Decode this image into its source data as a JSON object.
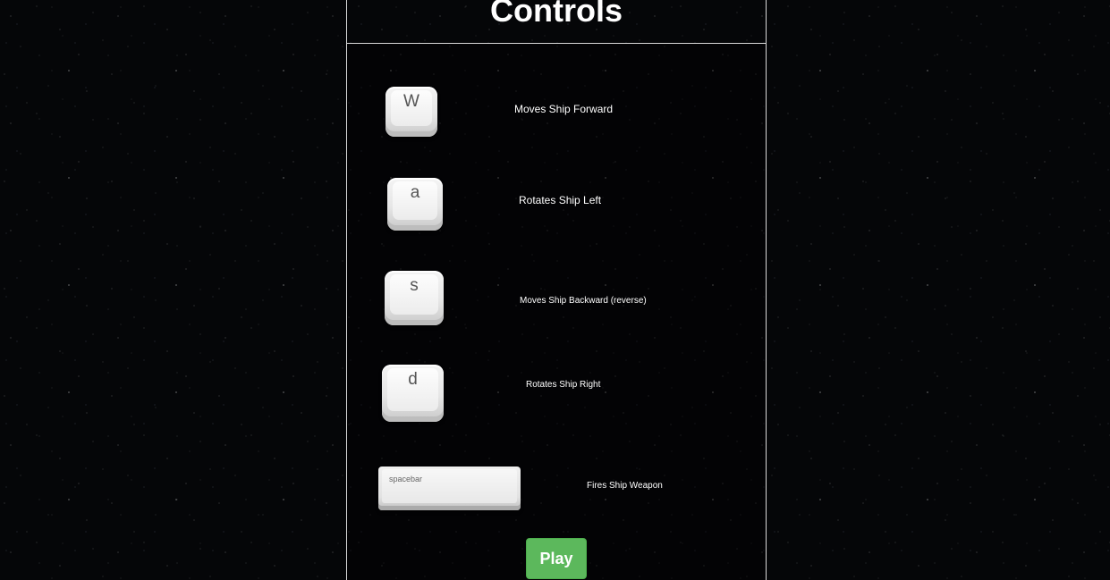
{
  "header": {
    "title": "Controls"
  },
  "controls": [
    {
      "key": "W",
      "description": "Moves Ship Forward"
    },
    {
      "key": "a",
      "description": "Rotates Ship Left"
    },
    {
      "key": "s",
      "description": "Moves Ship Backward (reverse)"
    },
    {
      "key": "d",
      "description": "Rotates Ship Right"
    },
    {
      "key": "spacebar",
      "description": "Fires Ship Weapon"
    }
  ],
  "actions": {
    "play_label": "Play"
  },
  "colors": {
    "play_button": "#5cb85c",
    "panel_border": "#d8d8d8",
    "text": "#ffffff",
    "background": "#050608"
  },
  "icons": [
    "w-key-icon",
    "a-key-icon",
    "s-key-icon",
    "d-key-icon",
    "spacebar-key-icon"
  ]
}
